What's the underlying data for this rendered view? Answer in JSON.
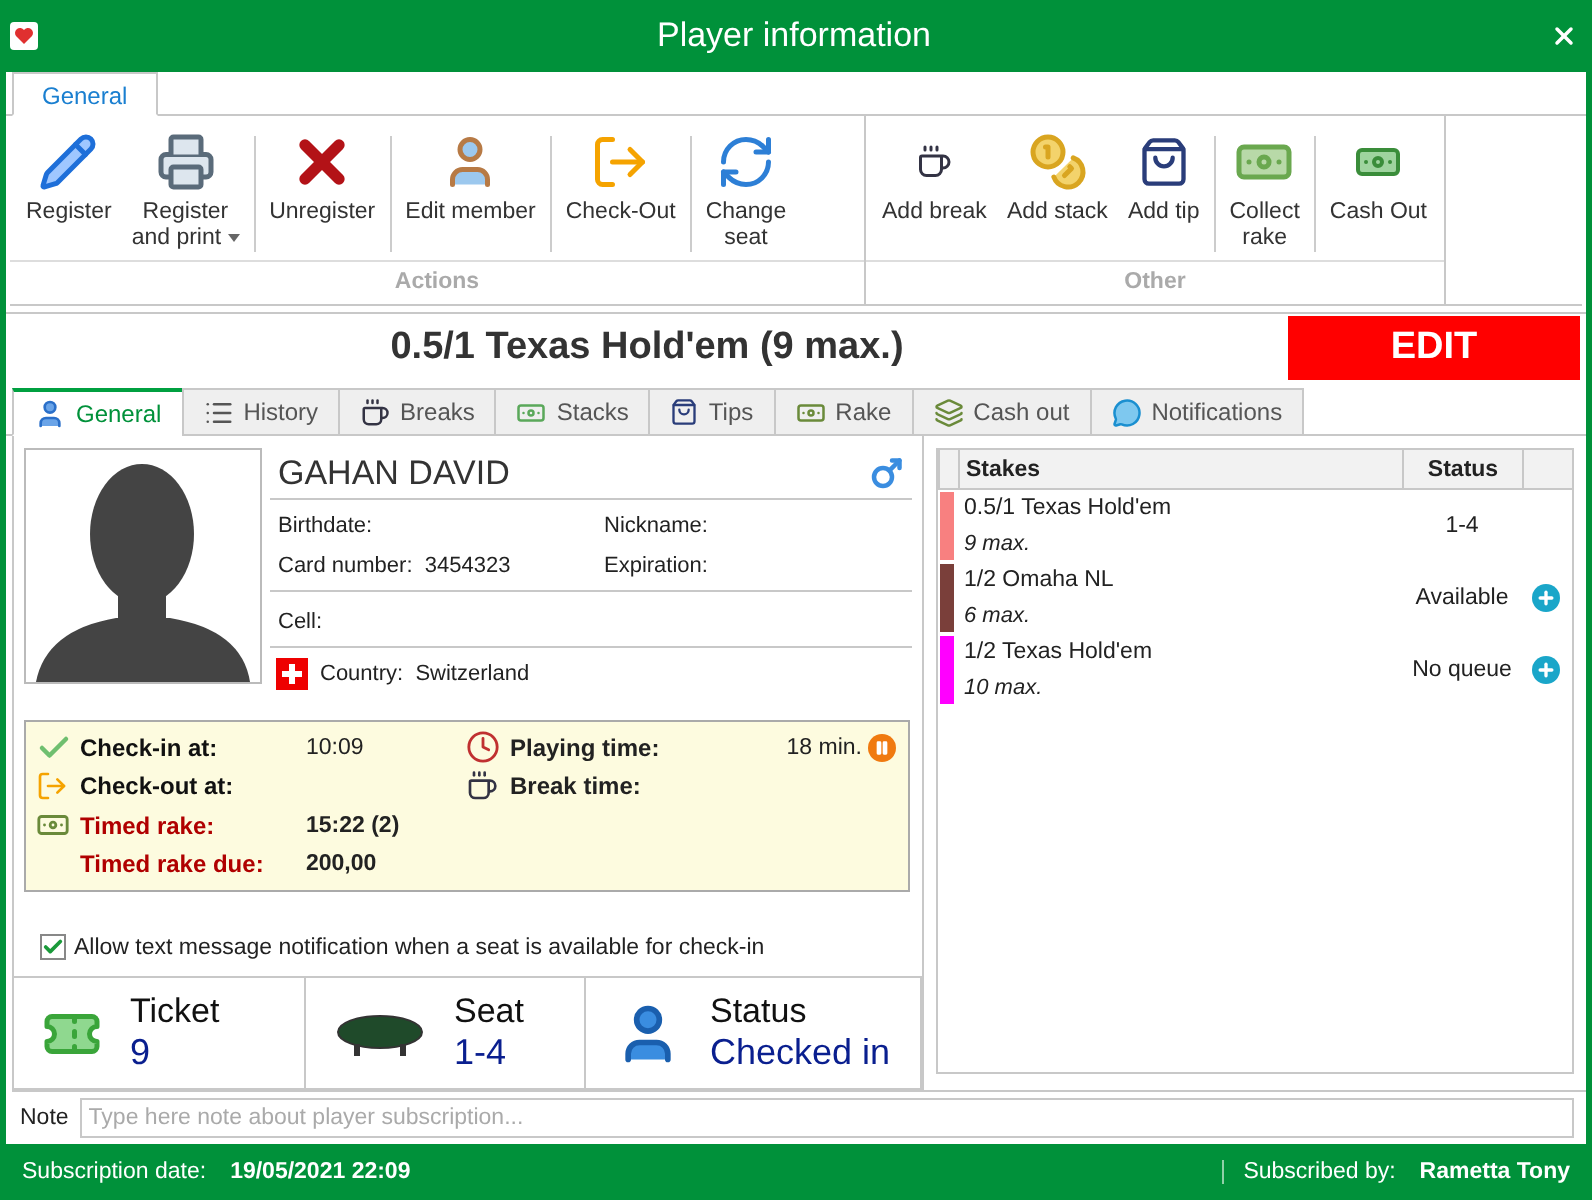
{
  "window": {
    "title": "Player information"
  },
  "ribbon": {
    "tabs": [
      {
        "label": "General",
        "selected": true
      }
    ],
    "groups": [
      {
        "label": "Actions",
        "buttons": [
          {
            "label": "Register",
            "dropdown": false,
            "divider_after": false
          },
          {
            "label": "Register\nand print",
            "dropdown": true,
            "divider_after": true
          },
          {
            "label": "Unregister",
            "dropdown": false,
            "divider_after": true
          },
          {
            "label": "Edit member",
            "dropdown": false,
            "divider_after": true
          },
          {
            "label": "Check-Out",
            "dropdown": false,
            "divider_after": true
          },
          {
            "label": "Change\nseat",
            "dropdown": false,
            "divider_after": false
          }
        ]
      },
      {
        "label": "Other",
        "buttons": [
          {
            "label": "Add break",
            "dropdown": false,
            "divider_after": false
          },
          {
            "label": "Add stack",
            "dropdown": false,
            "divider_after": false
          },
          {
            "label": "Add tip",
            "dropdown": false,
            "divider_after": true
          },
          {
            "label": "Collect\nrake",
            "dropdown": false,
            "divider_after": true
          },
          {
            "label": "Cash Out",
            "dropdown": false,
            "divider_after": false
          }
        ]
      }
    ]
  },
  "header": {
    "title": "0.5/1 Texas Hold'em (9 max.)",
    "edit_button": "EDIT"
  },
  "tabs": [
    {
      "label": "General",
      "selected": true
    },
    {
      "label": "History",
      "selected": false
    },
    {
      "label": "Breaks",
      "selected": false
    },
    {
      "label": "Stacks",
      "selected": false
    },
    {
      "label": "Tips",
      "selected": false
    },
    {
      "label": "Rake",
      "selected": false
    },
    {
      "label": "Cash out",
      "selected": false
    },
    {
      "label": "Notifications",
      "selected": false
    }
  ],
  "player": {
    "name": "GAHAN DAVID",
    "fields": [
      {
        "label": "Birthdate:"
      },
      {
        "label": "Nickname:"
      },
      {
        "label": "Card number:",
        "value": "3454323"
      },
      {
        "label": "Expiration:"
      }
    ],
    "cell": {
      "label": "Cell:"
    },
    "country": {
      "label": "Country:",
      "value": "Switzerland"
    }
  },
  "times": {
    "left": [
      {
        "label": "Check-in at:",
        "value": "10:09",
        "kind": "normal"
      },
      {
        "label": "Check-out at:",
        "kind": "normal"
      },
      {
        "label": "Timed rake:",
        "value": "15:22 (2)",
        "kind": "alert"
      },
      {
        "label": "Timed rake due:",
        "value": "200,00",
        "kind": "alert"
      }
    ],
    "right": [
      {
        "label": "Playing time:",
        "value": "18 min."
      },
      {
        "label": "Break time:"
      }
    ]
  },
  "notification": {
    "label": "Allow text message notification when a seat is available for check-in",
    "checked": true
  },
  "tiles": [
    {
      "label": "Ticket",
      "value": "9"
    },
    {
      "label": "Seat",
      "value": "1-4"
    },
    {
      "label": "Status",
      "value": "Checked in"
    }
  ],
  "note": {
    "label": "Note",
    "placeholder": "Type here note about player subscription..."
  },
  "stakes": {
    "columns": [
      "Stakes",
      "Status"
    ],
    "rows": [
      {
        "name": "0.5/1 Texas Hold'em",
        "max": "9 max.",
        "status": "1-4",
        "color": "#f88080",
        "can_add": false
      },
      {
        "name": "1/2 Omaha NL",
        "max": "6 max.",
        "status": "Available",
        "color": "#7a3f3a",
        "can_add": true
      },
      {
        "name": "1/2 Texas Hold'em",
        "max": "10 max.",
        "status": "No queue",
        "color": "#ff00ff",
        "can_add": true
      }
    ]
  },
  "status_bar": {
    "subscription_label": "Subscription date:",
    "subscription_date": "19/05/2021 22:09",
    "subscribed_by_label": "Subscribed by:",
    "subscribed_by": "Rametta Tony"
  }
}
